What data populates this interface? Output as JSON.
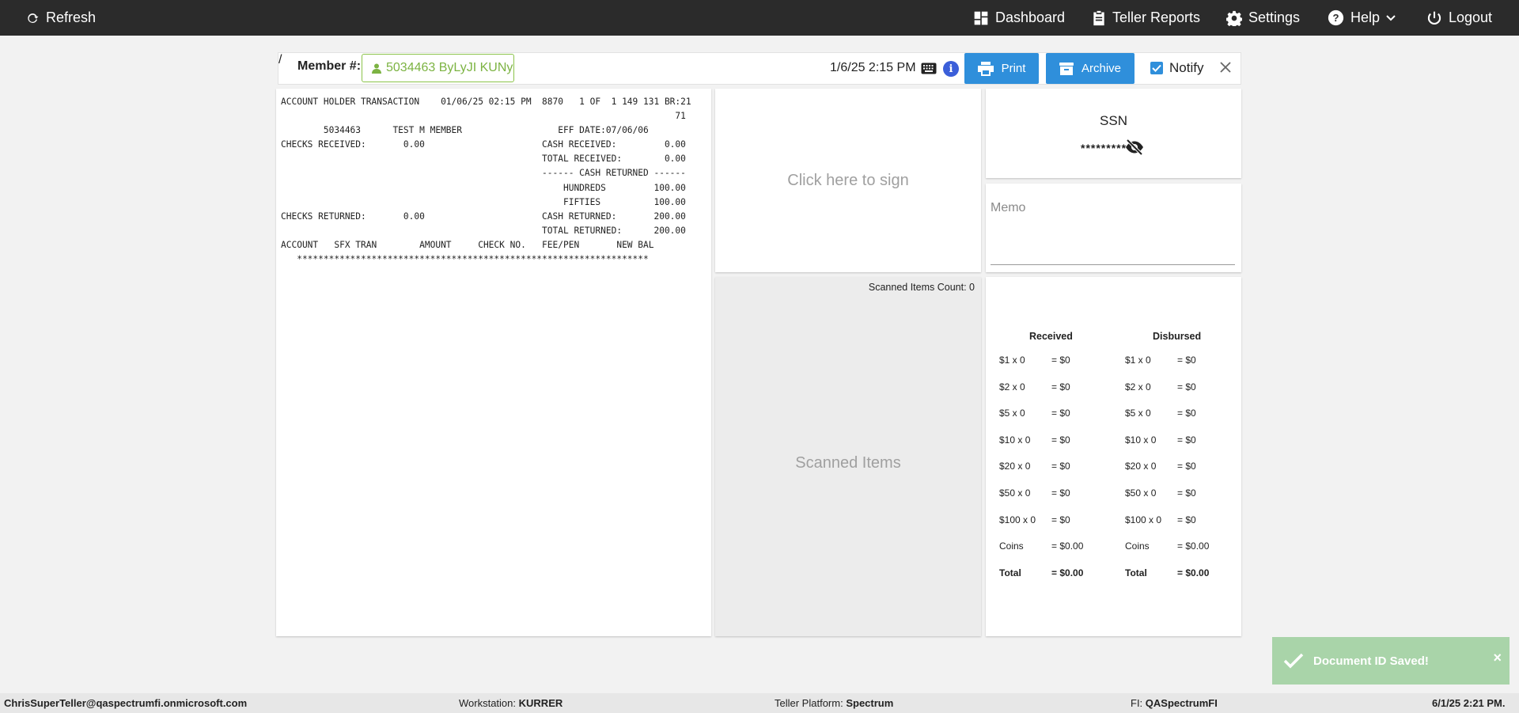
{
  "nav": {
    "refresh": "Refresh",
    "dashboard": "Dashboard",
    "teller_reports": "Teller Reports",
    "settings": "Settings",
    "help": "Help",
    "logout": "Logout"
  },
  "header": {
    "member_label": "Member #:",
    "member_value": "5034463 ByLyJI KUNy",
    "datetime": "1/6/25 2:15 PM",
    "print": "Print",
    "archive": "Archive",
    "notify": "Notify",
    "notify_checked": true
  },
  "receipt_lines": [
    "ACCOUNT HOLDER TRANSACTION    01/06/25 02:15 PM  8870   1 OF  1 149 131 BR:21",
    "                                                                          71",
    "        5034463      TEST M MEMBER                  EFF DATE:07/06/06",
    "CHECKS RECEIVED:       0.00                      CASH RECEIVED:         0.00",
    "                                                 TOTAL RECEIVED:        0.00",
    "                                                 ------ CASH RETURNED ------",
    "                                                     HUNDREDS         100.00",
    "                                                     FIFTIES          100.00",
    "CHECKS RETURNED:       0.00                      CASH RETURNED:       200.00",
    "                                                 TOTAL RETURNED:      200.00",
    "ACCOUNT   SFX TRAN        AMOUNT     CHECK NO.   FEE/PEN       NEW BAL",
    "   ******************************************************************"
  ],
  "signature": {
    "prompt": "Click here to sign"
  },
  "scanned": {
    "count_label": "Scanned Items Count: 0",
    "title": "Scanned Items"
  },
  "ssn": {
    "label": "SSN",
    "masked": "*********"
  },
  "memo": {
    "placeholder": "Memo"
  },
  "cash": {
    "received_title": "Received",
    "disbursed_title": "Disbursed",
    "received": [
      {
        "den": "$1 x 0",
        "amt": "= $0"
      },
      {
        "den": "$2 x 0",
        "amt": "= $0"
      },
      {
        "den": "$5 x 0",
        "amt": "= $0"
      },
      {
        "den": "$10 x 0",
        "amt": "= $0"
      },
      {
        "den": "$20 x 0",
        "amt": "= $0"
      },
      {
        "den": "$50 x 0",
        "amt": "= $0"
      },
      {
        "den": "$100 x 0",
        "amt": "= $0"
      },
      {
        "den": "Coins",
        "amt": "= $0.00"
      },
      {
        "den": "Total",
        "amt": "= $0.00"
      }
    ],
    "disbursed": [
      {
        "den": "$1 x 0",
        "amt": "= $0"
      },
      {
        "den": "$2 x 0",
        "amt": "= $0"
      },
      {
        "den": "$5 x 0",
        "amt": "= $0"
      },
      {
        "den": "$10 x 0",
        "amt": "= $0"
      },
      {
        "den": "$20 x 0",
        "amt": "= $0"
      },
      {
        "den": "$50 x 0",
        "amt": "= $0"
      },
      {
        "den": "$100 x 0",
        "amt": "= $0"
      },
      {
        "den": "Coins",
        "amt": "= $0.00"
      },
      {
        "den": "Total",
        "amt": "= $0.00"
      }
    ]
  },
  "toast": {
    "message": "Document ID Saved!",
    "close": "×"
  },
  "footer": {
    "user": "ChrisSuperTeller@qaspectrumfi.onmicrosoft.com",
    "workstation_label": "Workstation:",
    "workstation": "KURRER",
    "platform_label": "Teller Platform:",
    "platform": "Spectrum",
    "fi_label": "FI:",
    "fi": "QASpectrumFI",
    "datetime": "6/1/25 2:21 PM."
  },
  "colors": {
    "topbar": "#2b2b2b",
    "accent_blue": "#2f8fdb",
    "member_green": "#7cb342",
    "toast_green": "#a9d4a9"
  }
}
